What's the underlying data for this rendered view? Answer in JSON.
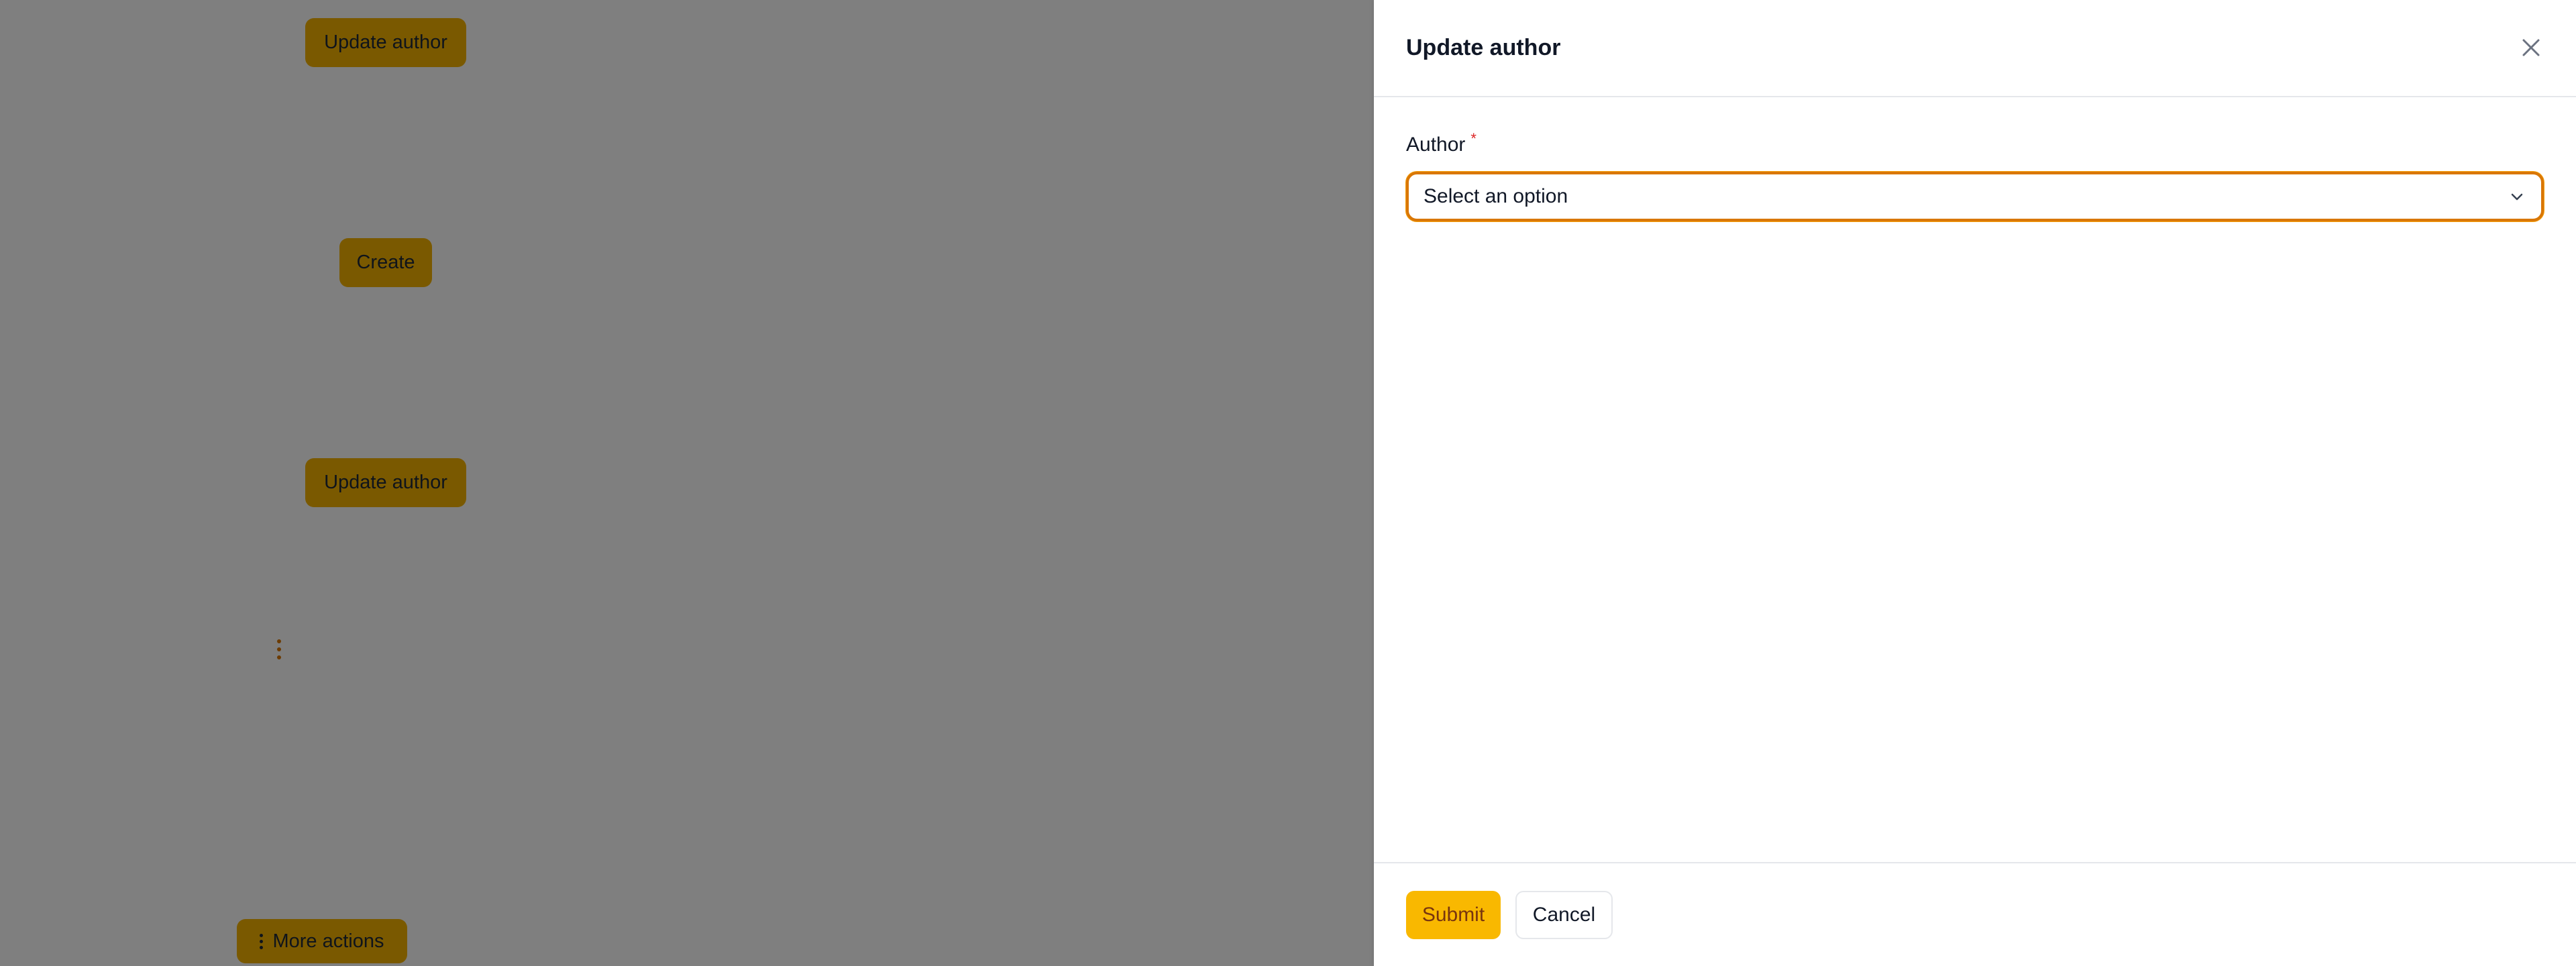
{
  "background": {
    "buttons": {
      "update_author_1": "Update author",
      "create": "Create",
      "update_author_2": "Update author",
      "more_actions": "More actions"
    }
  },
  "panel": {
    "title": "Update author",
    "field": {
      "label": "Author",
      "required_mark": "*",
      "placeholder": "Select an option"
    },
    "footer": {
      "submit_label": "Submit",
      "cancel_label": "Cancel"
    }
  },
  "icons": {
    "close": "close-icon",
    "chevron": "chevron-down-icon",
    "kebab": "vertical-dots-icon"
  },
  "colors": {
    "accent": "#f9b800",
    "focus_ring": "#d97706",
    "required": "#dc2626",
    "overlay": "rgba(0,0,0,0.5)"
  }
}
